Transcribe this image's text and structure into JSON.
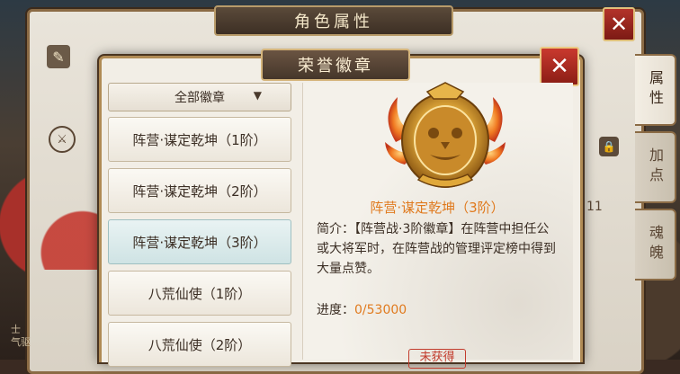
{
  "outer_window": {
    "title": "角色属性",
    "close_label": "✕",
    "side_tabs": [
      "属性",
      "加点",
      "魂魄"
    ],
    "number_fragment": "11",
    "left_text": "士\n气驱"
  },
  "dialog": {
    "title": "荣誉徽章",
    "close_label": "✕",
    "filter": {
      "selected": "全部徽章",
      "arrow": "▼"
    },
    "items": [
      {
        "label": "阵营·谋定乾坤（1阶）"
      },
      {
        "label": "阵营·谋定乾坤（2阶）"
      },
      {
        "label": "阵营·谋定乾坤（3阶）"
      },
      {
        "label": "八荒仙使（1阶）"
      },
      {
        "label": "八荒仙使（2阶）"
      }
    ],
    "detail": {
      "badge_name": "阵营·谋定乾坤（3阶）",
      "description": "简介：【阵营战·3阶徽章】在阵营中担任公或大将军时，在阵营战的管理评定榜中得到大量点赞。",
      "progress_label": "进度：",
      "progress_value": "0/53000",
      "status": "未获得"
    }
  },
  "colors": {
    "accent_orange": "#e07a1e",
    "close_red": "#c9392e",
    "selected_item": "#cfe3e4"
  }
}
